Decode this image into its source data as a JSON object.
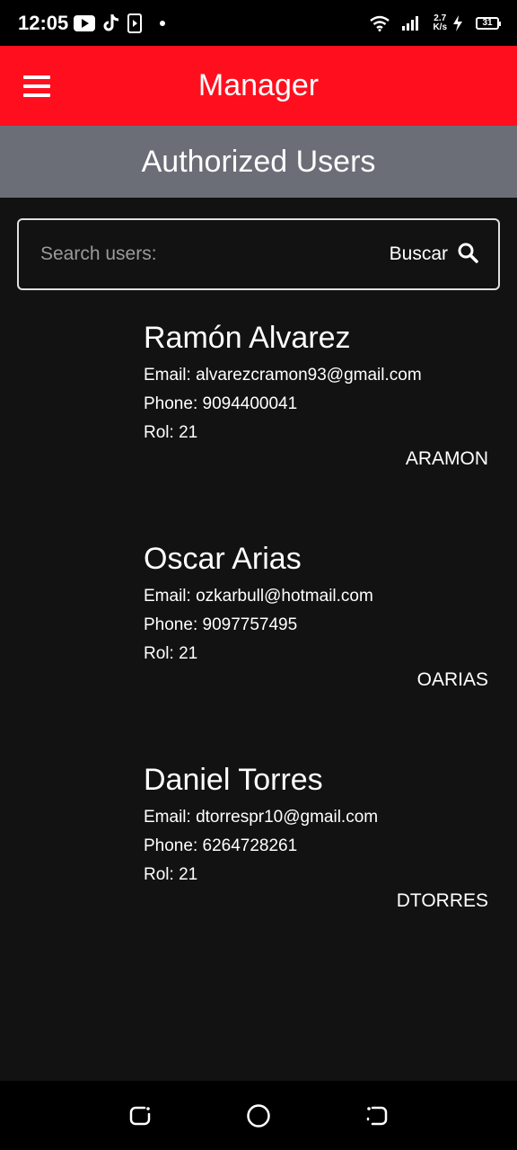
{
  "status_bar": {
    "time": "12:05",
    "net_speed_value": "2.7",
    "net_speed_unit": "K/s",
    "battery": "31",
    "icons": [
      "youtube-icon",
      "tiktok-icon",
      "media-icon",
      "dot-icon",
      "wifi-icon",
      "signal-icon",
      "charging-icon",
      "battery-icon"
    ]
  },
  "app_bar": {
    "title": "Manager",
    "menu_icon": "hamburger-menu-icon"
  },
  "section": {
    "title": "Authorized Users"
  },
  "search": {
    "placeholder": "Search users:",
    "value": "",
    "button_label": "Buscar",
    "button_icon": "search-icon"
  },
  "users": [
    {
      "name": "Ramón Alvarez",
      "email": "Email: alvarezcramon93@gmail.com",
      "phone": "Phone: 9094400041",
      "rol": "Rol: 21",
      "username": "ARAMON"
    },
    {
      "name": "Oscar Arias",
      "email": "Email: ozkarbull@hotmail.com",
      "phone": "Phone: 9097757495",
      "rol": "Rol: 21",
      "username": "OARIAS"
    },
    {
      "name": "Daniel Torres",
      "email": "Email: dtorrespr10@gmail.com",
      "phone": "Phone: 6264728261",
      "rol": "Rol: 21",
      "username": "DTORRES"
    }
  ],
  "nav_bar": {
    "icons": [
      "recents-icon",
      "home-icon",
      "back-icon"
    ]
  },
  "colors": {
    "app_bar": "#ff0f1e",
    "section_header": "#6b6e77",
    "background": "#121212",
    "text": "#ffffff"
  }
}
